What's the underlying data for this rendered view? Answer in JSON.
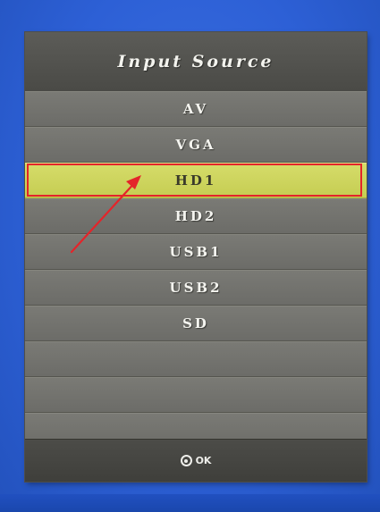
{
  "osd": {
    "title": "Input Source",
    "items": [
      {
        "label": "AV",
        "selected": false
      },
      {
        "label": "VGA",
        "selected": false
      },
      {
        "label": "HD1",
        "selected": true
      },
      {
        "label": "HD2",
        "selected": false
      },
      {
        "label": "USB1",
        "selected": false
      },
      {
        "label": "USB2",
        "selected": false
      },
      {
        "label": "SD",
        "selected": false
      },
      {
        "label": "",
        "selected": false
      },
      {
        "label": "",
        "selected": false
      },
      {
        "label": "",
        "selected": false
      }
    ],
    "footer": {
      "icon": "ok-button-icon",
      "ok_label": "OK"
    }
  },
  "colors": {
    "screen_background": "#2d60d6",
    "panel": "#6e6e6a",
    "selected_row": "#c5cd52",
    "annotation": "#e4242a"
  }
}
